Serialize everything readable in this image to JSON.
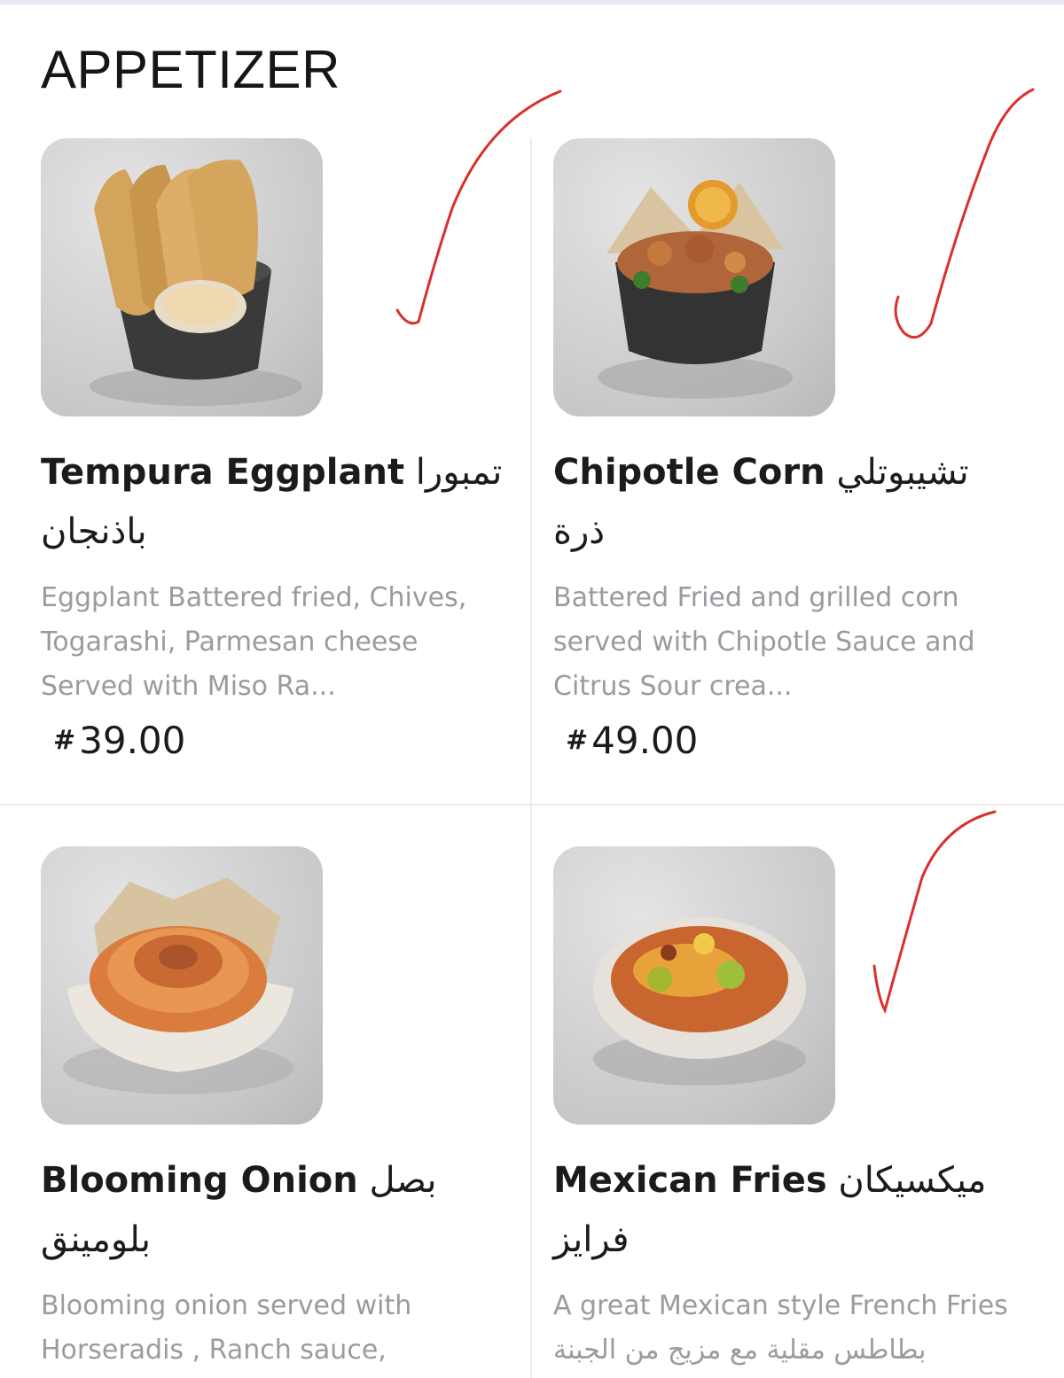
{
  "section": {
    "title": "APPETIZER"
  },
  "currency_symbol": "⃁",
  "items": [
    {
      "name_en": "Tempura Eggplant",
      "name_ar": "تمبورا باذنجان",
      "description": "Eggplant Battered fried, Chives, Togarashi, Parmesan cheese Served with Miso Ra...",
      "price": "39.00",
      "image": "tempura-eggplant-photo",
      "checked": true
    },
    {
      "name_en": "Chipotle Corn",
      "name_ar": "تشيبوتلي ذرة",
      "description": "Battered Fried and grilled corn served with Chipotle Sauce and Citrus Sour crea...",
      "price": "49.00",
      "image": "chipotle-corn-photo",
      "checked": true
    },
    {
      "name_en": "Blooming Onion",
      "name_ar": "بصل بلومينق",
      "description": "Blooming onion served with Horseradis , Ranch sauce,",
      "image": "blooming-onion-photo",
      "checked": false
    },
    {
      "name_en": "Mexican Fries",
      "name_ar": "ميكسيكان فرايز",
      "description": "A great Mexican style French Fries بطاطس مقلية مع مزيج من الجبنة",
      "image": "mexican-fries-photo",
      "checked": true
    }
  ],
  "colors": {
    "check_mark": "#d9302c",
    "divider": "#ececef",
    "description": "#9a9aa0"
  }
}
